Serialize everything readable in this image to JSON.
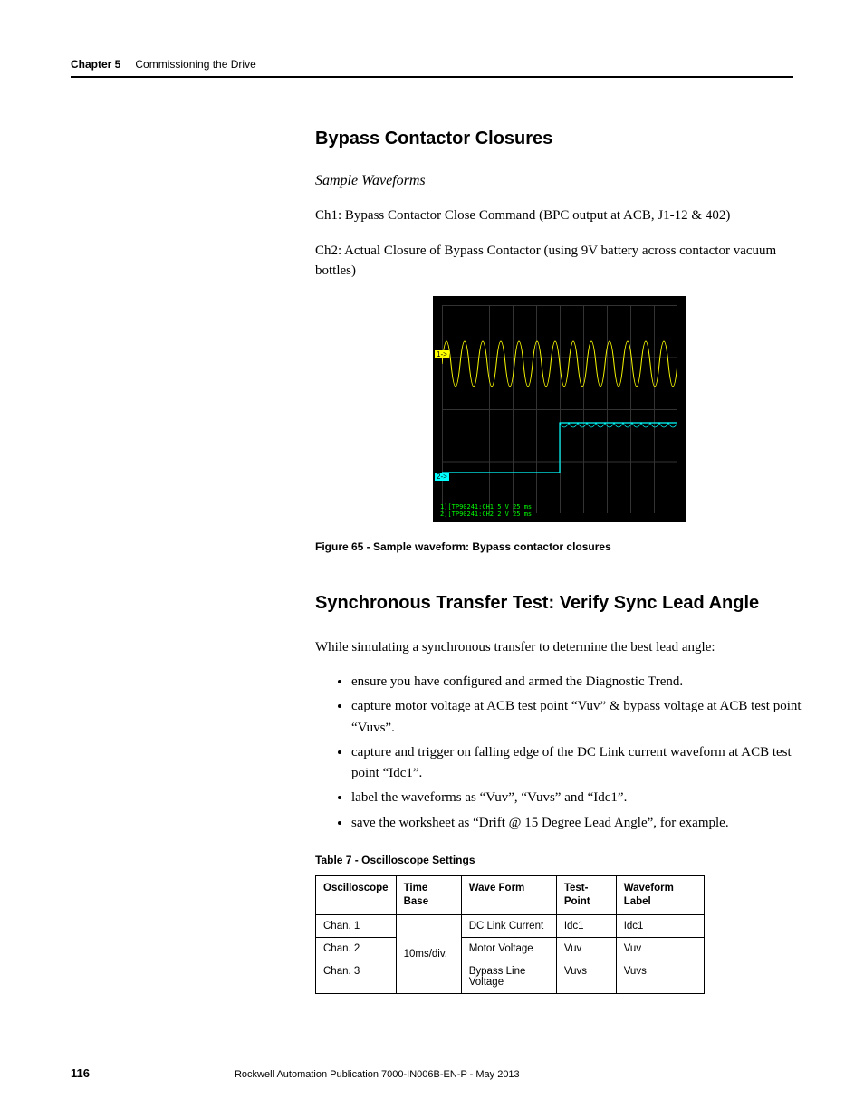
{
  "header": {
    "chapter": "Chapter 5",
    "title": "Commissioning the Drive"
  },
  "section1": {
    "heading": "Bypass Contactor Closures",
    "subheading": "Sample Waveforms",
    "p1": "Ch1: Bypass Contactor Close Command (BPC output at ACB, J1-12 & 402)",
    "p2": "Ch2: Actual Closure of Bypass Contactor (using 9V battery across contactor vacuum bottles)",
    "figcaption": "Figure 65 - Sample waveform: Bypass contactor closures",
    "scope_marker1": "1->",
    "scope_marker2": "2->",
    "scope_footer_line1": "1)[TP90241:CH1 5 V 25 ms",
    "scope_footer_line2": "2)[TP90241:CH2 2 V 25 ms"
  },
  "section2": {
    "heading": "Synchronous Transfer Test: Verify Sync Lead Angle",
    "p1": "While simulating a synchronous transfer to determine the best lead angle:",
    "bullets": [
      "ensure you have configured and armed the Diagnostic Trend.",
      "capture motor voltage at ACB test point “Vuv” & bypass voltage at ACB test point “Vuvs”.",
      "capture and trigger on falling edge of the DC Link current waveform at ACB test point “Idc1”.",
      "label the waveforms as “Vuv”, “Vuvs” and “Idc1”.",
      "save the worksheet as “Drift @ 15 Degree Lead Angle”, for example."
    ],
    "tablecaption": "Table 7 - Oscilloscope Settings",
    "table": {
      "headers": [
        "Oscilloscope",
        "Time Base",
        "Wave Form",
        "Test-Point",
        "Waveform Label"
      ],
      "rows": [
        [
          "Chan. 1",
          "10ms/div.",
          "DC Link Current",
          "Idc1",
          "Idc1"
        ],
        [
          "Chan. 2",
          "",
          "Motor Voltage",
          "Vuv",
          "Vuv"
        ],
        [
          "Chan. 3",
          "",
          "Bypass Line Voltage",
          "Vuvs",
          "Vuvs"
        ]
      ],
      "timebase_rowspan": 3
    }
  },
  "footer": {
    "page": "116",
    "pub": "Rockwell Automation Publication 7000-IN006B-EN-P - May 2013"
  }
}
